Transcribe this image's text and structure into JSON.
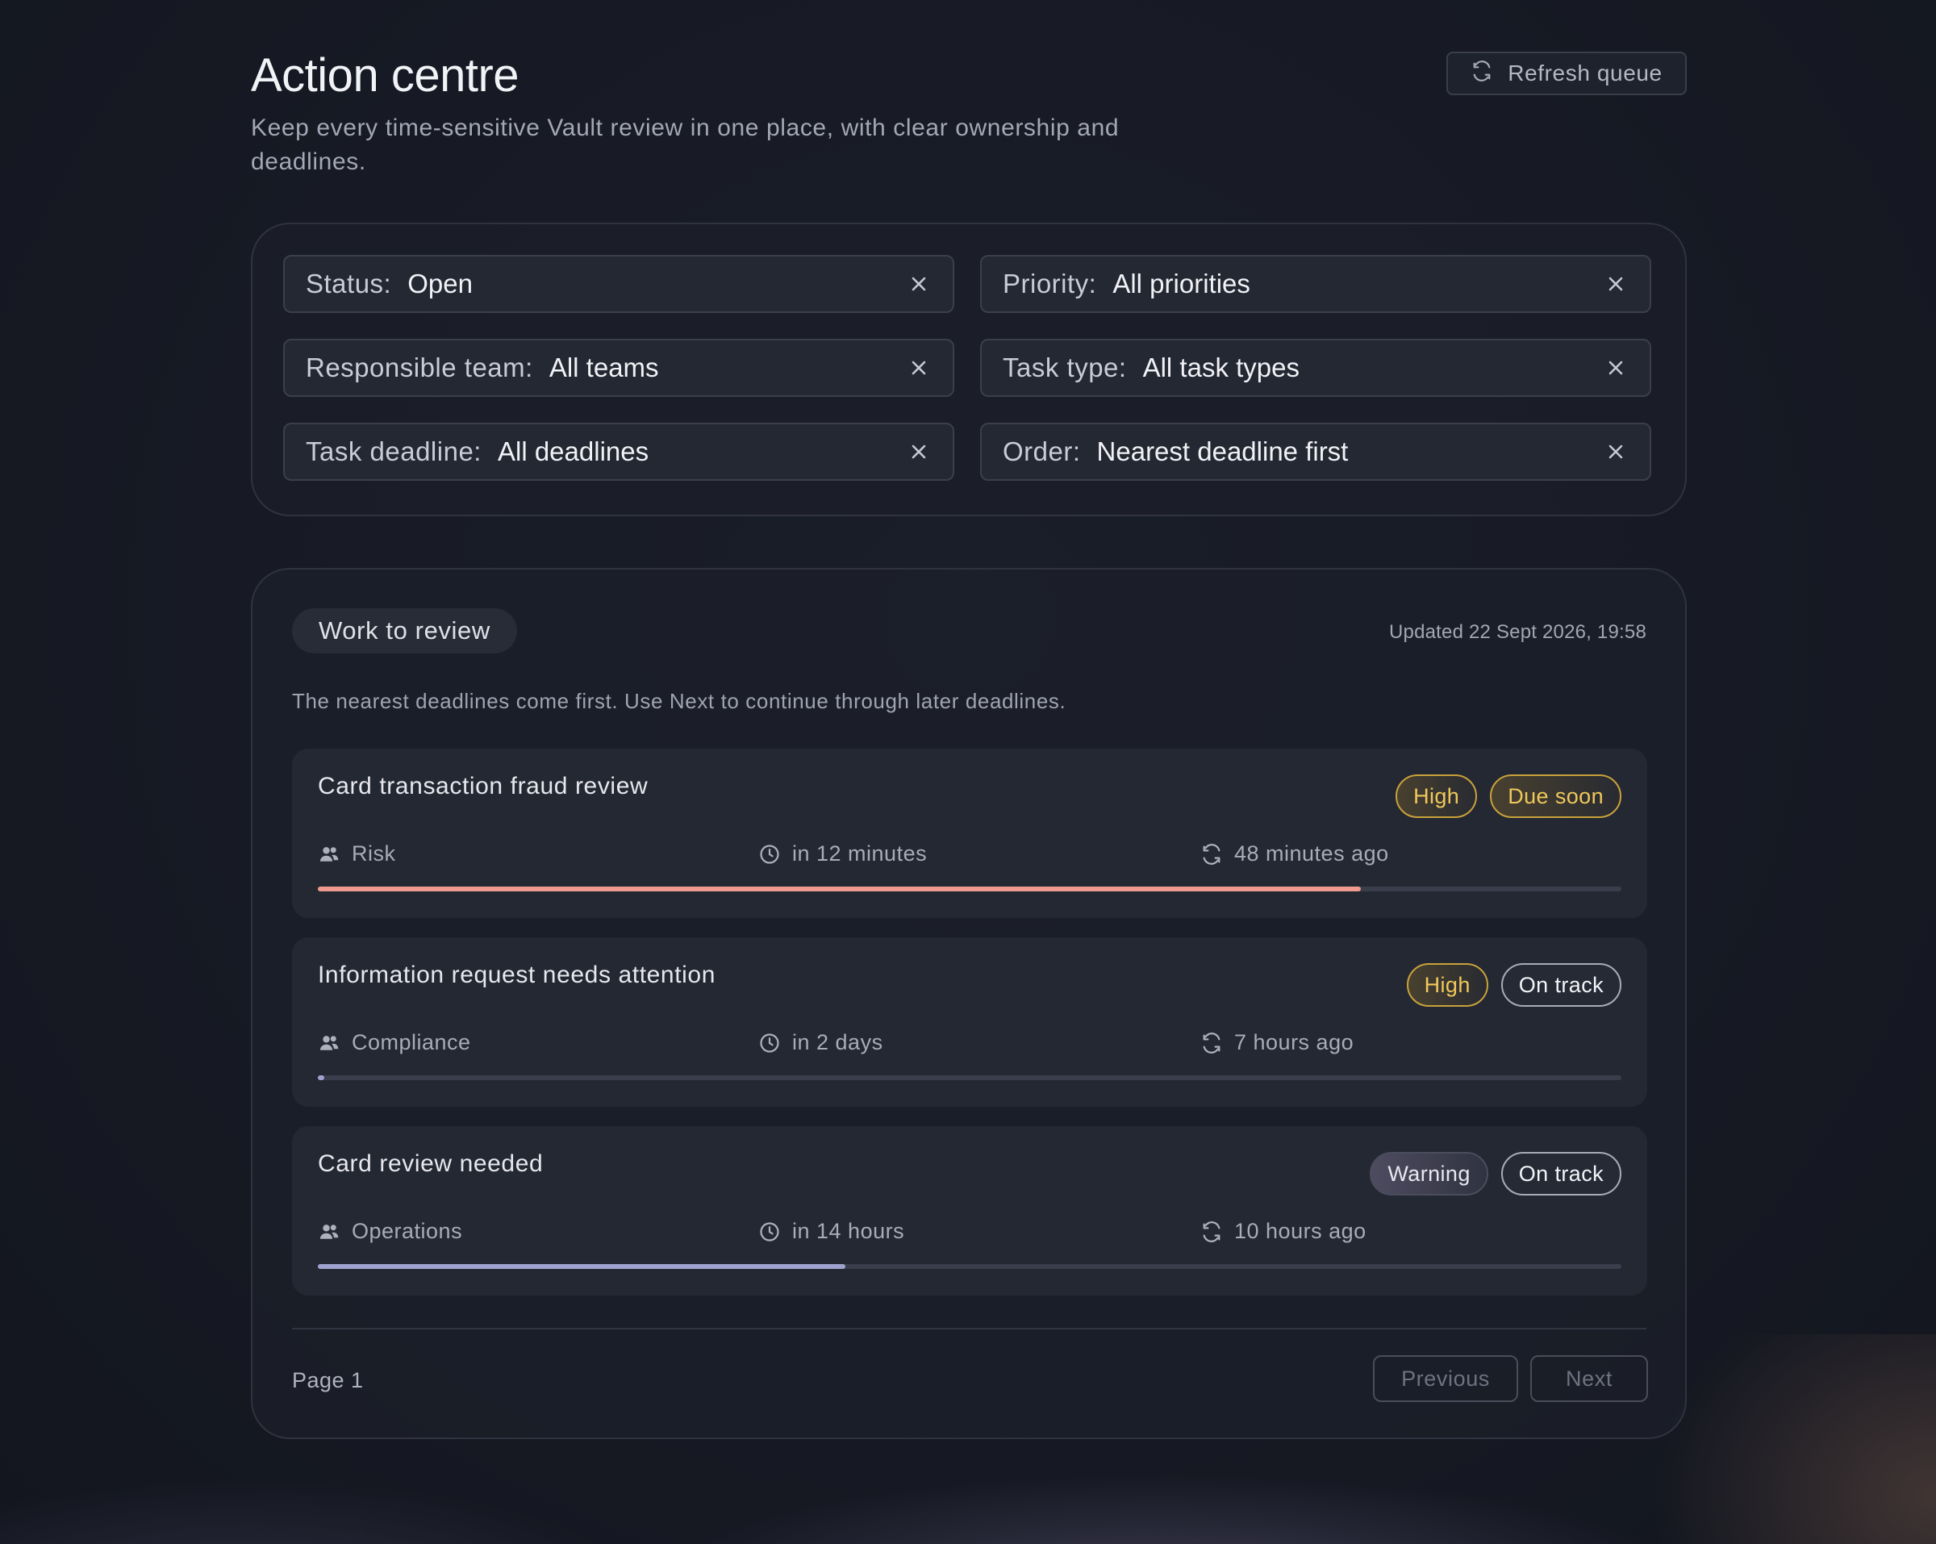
{
  "header": {
    "title": "Action centre",
    "subtitle": "Keep every time-sensitive Vault review in one place, with clear ownership and deadlines.",
    "refresh_label": "Refresh queue"
  },
  "filters": [
    {
      "key": "Status:",
      "value": "Open"
    },
    {
      "key": "Priority:",
      "value": "All priorities"
    },
    {
      "key": "Responsible team:",
      "value": "All teams"
    },
    {
      "key": "Task type:",
      "value": "All task types"
    },
    {
      "key": "Task deadline:",
      "value": "All deadlines"
    },
    {
      "key": "Order:",
      "value": "Nearest deadline first"
    }
  ],
  "review": {
    "section_label": "Work to review",
    "updated": "Updated 22 Sept 2026, 19:58",
    "hint": "The nearest deadlines come first. Use Next to continue through later deadlines.",
    "tasks": [
      {
        "title": "Card transaction fraud review",
        "badges": [
          "High",
          "Due soon"
        ],
        "team": "Risk",
        "due": "in 12 minutes",
        "updated": "48 minutes ago",
        "progress": 0.8,
        "progress_color": "#ee9a8c"
      },
      {
        "title": "Information request needs attention",
        "badges": [
          "High",
          "On track"
        ],
        "team": "Compliance",
        "due": "in 2 days",
        "updated": "7 hours ago",
        "progress": 0.005,
        "progress_color": "#9fa2cf"
      },
      {
        "title": "Card review needed",
        "badges": [
          "Warning",
          "On track"
        ],
        "team": "Operations",
        "due": "in 14 hours",
        "updated": "10 hours ago",
        "progress": 0.405,
        "progress_color": "#9fa2cf"
      }
    ]
  },
  "pagination": {
    "page_label": "Page 1",
    "previous_label": "Previous",
    "next_label": "Next"
  },
  "icons": {
    "refresh": "refresh-icon",
    "close": "close-icon",
    "team": "users-icon",
    "deadline": "clock-icon",
    "updated": "refresh-icon"
  }
}
